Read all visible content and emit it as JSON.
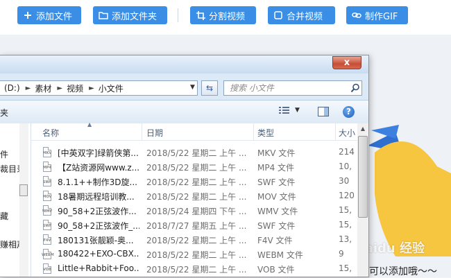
{
  "toolbar": {
    "add_file": "添加文件",
    "add_folder": "添加文件夹",
    "split_video": "分割视频",
    "merge_video": "合并视频",
    "make_gif": "制作GIF",
    "button_color": "#3a8ee6"
  },
  "dialog": {
    "close_glyph": "x",
    "address": {
      "drive": "(D:)",
      "crumbs": [
        "素材",
        "视频",
        "小文件"
      ]
    },
    "search_placeholder": "搜索 小文件",
    "command_label": "夹",
    "nav_items": [
      "件",
      "裁目录",
      "藏",
      "赚相声"
    ],
    "columns": {
      "name": "名称",
      "date": "日期",
      "type": "类型",
      "size": "大小"
    },
    "files": [
      {
        "name": "[中英双字]绿箭侠第...",
        "date": "2018/5/22 星期二 上午 ...",
        "type": "MKV 文件",
        "size": "214",
        "icon": "MKV"
      },
      {
        "name": "【Z站资源网www.z...",
        "date": "2018/5/22 星期二 上午 ...",
        "type": "MP4 文件",
        "size": "10,",
        "icon": "MP4"
      },
      {
        "name": "8.1.1++制作3D旋...",
        "date": "2018/5/22 星期二 上午 ...",
        "type": "SWF 文件",
        "size": "30",
        "icon": "SWF"
      },
      {
        "name": "18暑期远程培训教...",
        "date": "2018/5/22 星期二 上午 ...",
        "type": "MOV 文件",
        "size": "120",
        "icon": "MOV"
      },
      {
        "name": "90_58+2正弦波作...",
        "date": "2018/5/24 星期四 下午 ...",
        "type": "WMV 文件",
        "size": "15,",
        "icon": "WMV"
      },
      {
        "name": "90_58+2正弦波作_...",
        "date": "2018/7/27 星期五 上午 ...",
        "type": "SWF 文件",
        "size": "15,",
        "icon": "SWF"
      },
      {
        "name": "180131张靓颖-奥...",
        "date": "2018/5/22 星期二 上午 ...",
        "type": "F4V 文件",
        "size": "13,",
        "icon": "F4V"
      },
      {
        "name": "180422+EXO-CBX...",
        "date": "2018/5/22 星期二 上午 ...",
        "type": "WEBM 文件",
        "size": "9",
        "icon": "WEBM"
      },
      {
        "name": "Little+Rabbit+Foo...",
        "date": "2018/5/22 星期二 上午 ...",
        "type": "VOB 文件",
        "size": "15,",
        "icon": "VOB"
      }
    ]
  },
  "background": {
    "hint_text": "可以添加哦～～",
    "watermark": "Baidu 经验"
  }
}
